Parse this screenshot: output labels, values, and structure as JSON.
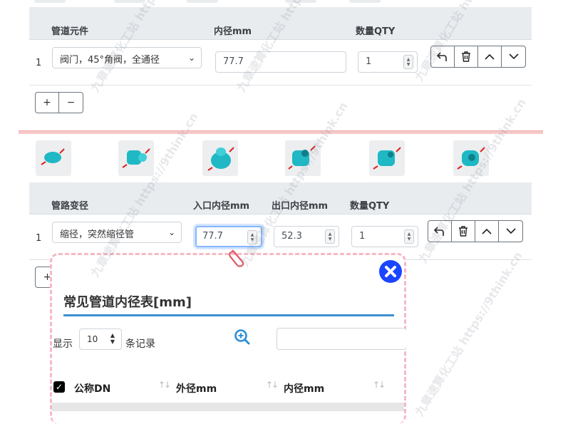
{
  "colors": {
    "accent": "#1b46ff",
    "header_band": "#e9ecef",
    "divider_red": "#f7c9c9",
    "popup_border": "#f7b8c4",
    "underline": "#3d8fd1"
  },
  "section1": {
    "headers": {
      "component": "管道元件",
      "inner_diameter": "内径mm",
      "qty": "数量QTY"
    },
    "row": {
      "index": "1",
      "component_value": "阀门，45°角阀，全通径",
      "inner_diameter_value": "77.7",
      "qty_value": "1"
    },
    "add_label": "+",
    "remove_label": "−"
  },
  "section2": {
    "headers": {
      "component": "管路变径",
      "inlet": "入口内径mm",
      "outlet": "出口内径mm",
      "qty": "数量QTY"
    },
    "row": {
      "index": "1",
      "component_value": "缩径，突然缩径管",
      "inlet_value": "77.7",
      "outlet_value": "52.3",
      "qty_value": "1"
    },
    "add_label": "+"
  },
  "icons": [
    "reset-icon",
    "trash-icon",
    "chevron-up-icon",
    "chevron-down-icon",
    "paperclip-icon",
    "close-icon",
    "zoom-in-icon"
  ],
  "popup": {
    "title": "常见管道内径表[mm]",
    "show_label": "显示",
    "page_size": "10",
    "records_label": "条记录",
    "search_value": "",
    "columns": [
      "公称DN",
      "外径mm",
      "内径mm"
    ],
    "sort_glyph": "↑↓"
  },
  "watermark": "九章速算化工站 https://9think.cn"
}
